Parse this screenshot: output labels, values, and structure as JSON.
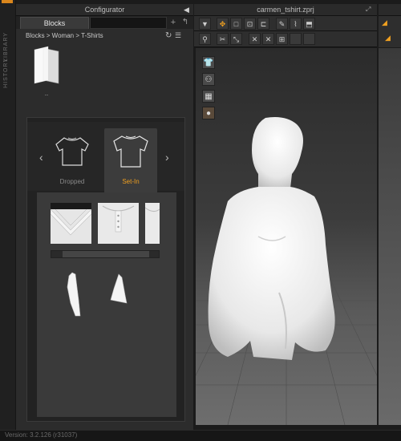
{
  "sidebar": {
    "tabs": [
      "LIBRARY",
      "HISTORY"
    ]
  },
  "configurator": {
    "title": "Configurator",
    "tabs": [
      "Blocks"
    ],
    "breadcrumb": "Blocks > Woman > T-Shirts",
    "folder_label": "..",
    "styles": [
      {
        "label": "Dropped",
        "selected": false
      },
      {
        "label": "Set-In",
        "selected": true
      }
    ]
  },
  "viewport": {
    "title": "carmen_tshirt.zprj",
    "toolbar_row1_icons": [
      "down-arrow-icon",
      "move-icon",
      "select-rect-icon",
      "transform-icon",
      "edit-point-icon",
      "pen-icon",
      "fold-icon",
      "garment-icon"
    ],
    "toolbar_row2_icons": [
      "avatar-pose-icon",
      "scissor-icon",
      "arrange-icon",
      "pin-icon",
      "sewing-icon",
      "tack-icon"
    ],
    "side_icons": [
      "shirt-icon",
      "avatar-display-icon",
      "texture-icon",
      "skin-icon"
    ]
  },
  "status": {
    "version": "Version: 3.2.126  (r31037)"
  },
  "colors": {
    "accent": "#f0a020",
    "panel": "#2c2c2c",
    "background": "#1b1b1b"
  }
}
